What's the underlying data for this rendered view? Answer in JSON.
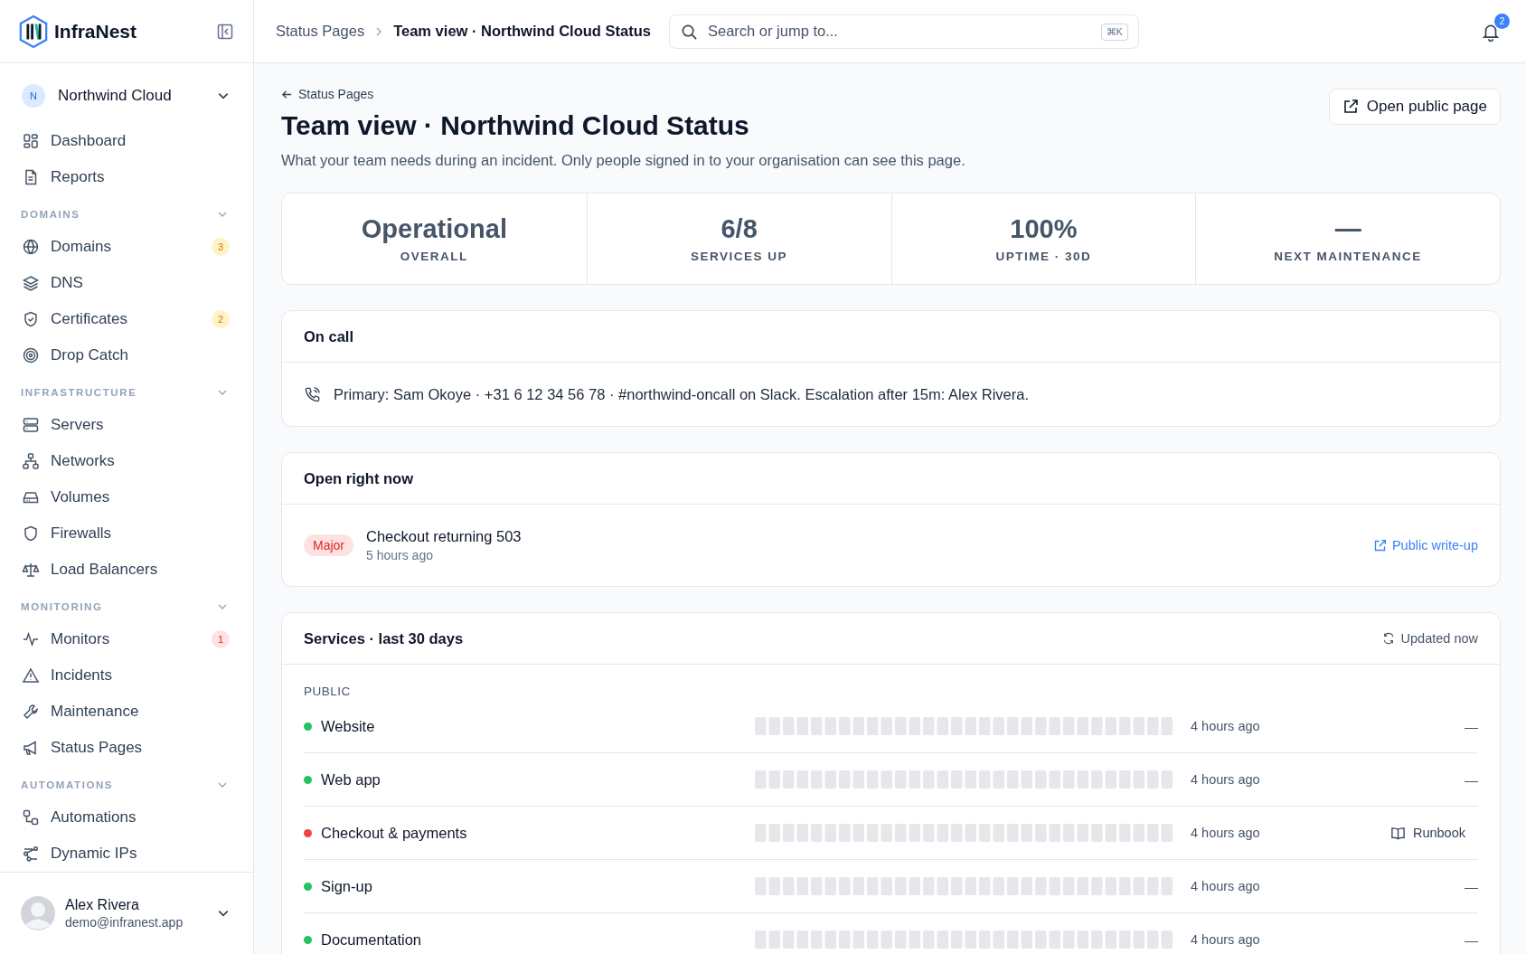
{
  "brand": "InfraNest",
  "org": {
    "initial": "N",
    "name": "Northwind Cloud"
  },
  "nav_top": [
    {
      "label": "Dashboard"
    },
    {
      "label": "Reports"
    }
  ],
  "sections": [
    {
      "title": "DOMAINS",
      "expanded": true,
      "items": [
        {
          "label": "Domains",
          "badge": "3",
          "kind": "warning"
        },
        {
          "label": "DNS"
        },
        {
          "label": "Certificates",
          "badge": "2",
          "kind": "warning"
        },
        {
          "label": "Drop Catch"
        }
      ]
    },
    {
      "title": "INFRASTRUCTURE",
      "expanded": true,
      "items": [
        {
          "label": "Servers"
        },
        {
          "label": "Networks"
        },
        {
          "label": "Volumes"
        },
        {
          "label": "Firewalls"
        },
        {
          "label": "Load Balancers"
        }
      ]
    },
    {
      "title": "MONITORING",
      "expanded": true,
      "items": [
        {
          "label": "Monitors",
          "badge": "1",
          "kind": "danger"
        },
        {
          "label": "Incidents"
        },
        {
          "label": "Maintenance"
        },
        {
          "label": "Status Pages"
        }
      ]
    },
    {
      "title": "AUTOMATIONS",
      "expanded": true,
      "items": [
        {
          "label": "Automations"
        },
        {
          "label": "Dynamic IPs"
        }
      ]
    }
  ],
  "user": {
    "name": "Alex Rivera",
    "email": "demo@infranest.app"
  },
  "breadcrumb": [
    "Status Pages",
    "Team view · Northwind Cloud Status"
  ],
  "search": {
    "placeholder": "Search or jump to...",
    "shortcut": "⌘K"
  },
  "notifications": {
    "count": "2"
  },
  "back_link": "Status Pages",
  "title": "Team view · Northwind Cloud Status",
  "description": "What your team needs during an incident. Only people signed in to your organisation can see this page.",
  "open_button": "Open public page",
  "stats": [
    {
      "value": "Operational",
      "label": "OVERALL"
    },
    {
      "value": "6/8",
      "label": "SERVICES UP"
    },
    {
      "value": "100%",
      "label": "UPTIME · 30D"
    },
    {
      "value": "—",
      "label": "NEXT MAINTENANCE"
    }
  ],
  "on_call": {
    "title": "On call",
    "text": "Primary: Sam Okoye · +31 6 12 34 56 78 · #northwind-oncall on Slack. Escalation after 15m: Alex Rivera."
  },
  "open_now": {
    "title": "Open right now",
    "incidents": [
      {
        "severity": "Major",
        "title": "Checkout returning 503",
        "time": "5 hours ago",
        "link": "Public write-up"
      }
    ]
  },
  "services": {
    "title": "Services · last 30 days",
    "updated": "Updated now",
    "groups": [
      {
        "name": "PUBLIC",
        "rows": [
          {
            "name": "Website",
            "color": "#22c55e",
            "checked": "4 hours ago",
            "action": {
              "kind": "plain",
              "text": "—"
            }
          },
          {
            "name": "Web app",
            "color": "#22c55e",
            "checked": "4 hours ago",
            "action": {
              "kind": "plain",
              "text": "—"
            }
          },
          {
            "name": "Checkout & payments",
            "color": "#ef4444",
            "checked": "4 hours ago",
            "action": {
              "kind": "link",
              "text": "Runbook"
            }
          },
          {
            "name": "Sign-up",
            "color": "#22c55e",
            "checked": "4 hours ago",
            "action": {
              "kind": "plain",
              "text": "—"
            }
          },
          {
            "name": "Documentation",
            "color": "#22c55e",
            "checked": "4 hours ago",
            "action": {
              "kind": "plain",
              "text": "—"
            }
          }
        ]
      }
    ]
  }
}
